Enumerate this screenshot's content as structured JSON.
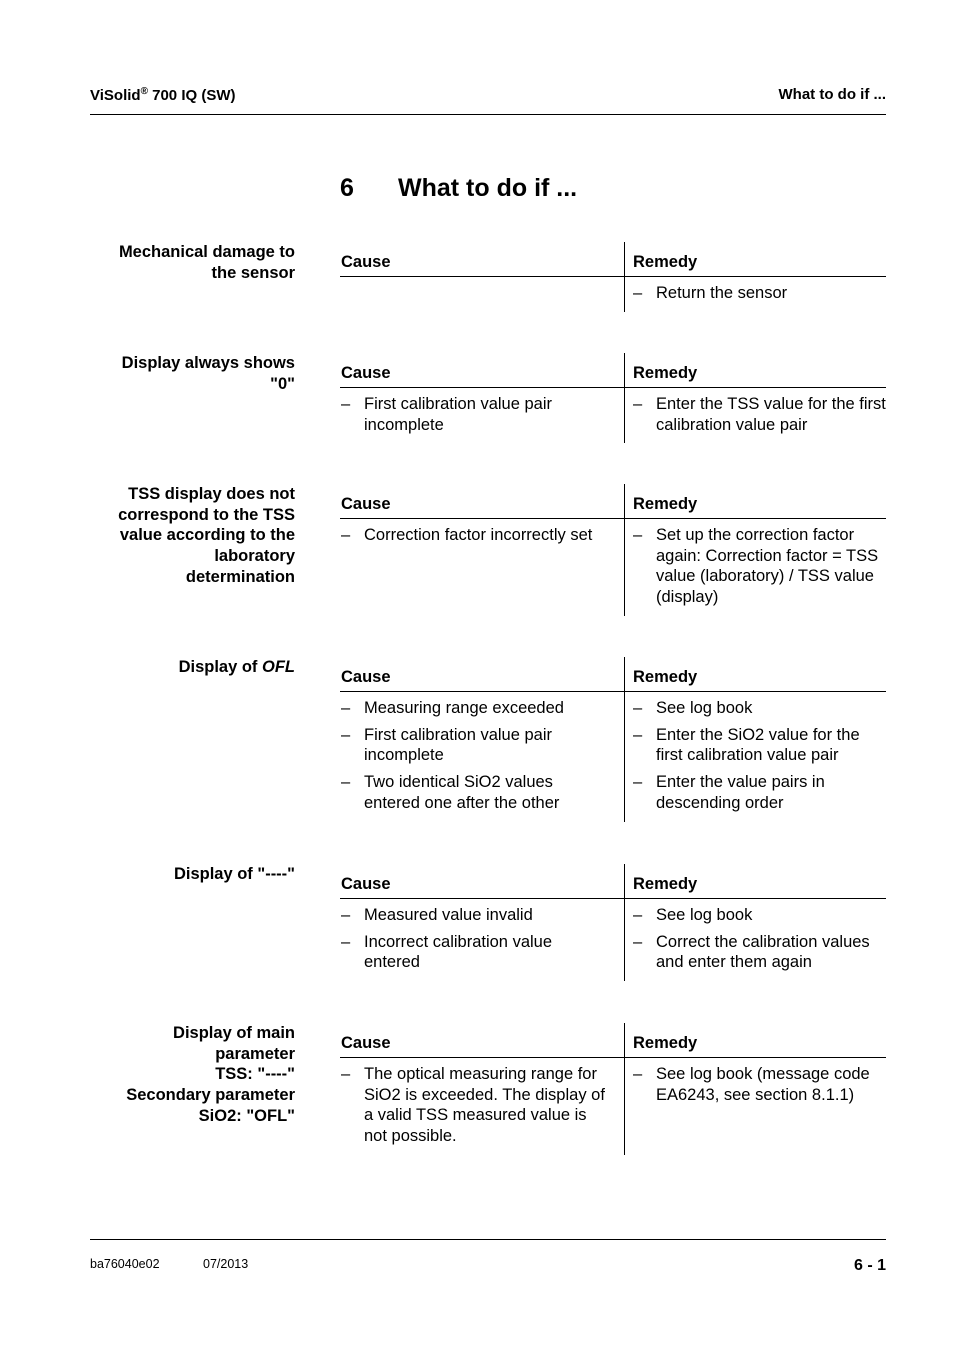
{
  "header": {
    "product": "ViSolid",
    "registered": "®",
    "model": " 700 IQ (SW)",
    "section": "What to do if ..."
  },
  "chapter": {
    "number": "6",
    "title": "What to do if ..."
  },
  "table_headers": {
    "cause": "Cause",
    "remedy": "Remedy"
  },
  "sections": [
    {
      "label": "Mechanical damage to the sensor",
      "causes": [],
      "remedies": [
        "Return the sensor"
      ]
    },
    {
      "label": "Display always shows \"0\"",
      "causes": [
        "First calibration value pair incomplete"
      ],
      "remedies": [
        "Enter the TSS value for the first calibration value pair"
      ]
    },
    {
      "label": "TSS display does not correspond to the TSS value according to the laboratory determination",
      "causes": [
        "Correction factor incorrectly set"
      ],
      "remedies": [
        "Set up the correction factor again: Correction factor = TSS value (laboratory) / TSS value (display)"
      ]
    },
    {
      "label": "Display of ",
      "label_italic": "OFL",
      "causes": [
        "Measuring range exceeded",
        "First calibration value pair incomplete",
        "Two identical SiO2 values entered one after the other"
      ],
      "remedies": [
        "See log book",
        "Enter the SiO2 value for the first calibration value pair",
        "Enter the value pairs in descending order"
      ]
    },
    {
      "label": "Display of \"----\"",
      "causes": [
        "Measured value invalid",
        "Incorrect calibration value entered"
      ],
      "remedies": [
        "See log book",
        "Correct the calibration values and enter them again"
      ]
    },
    {
      "label": "Display of main parameter TSS: \"----\" Secondary parameter SiO2: \"OFL\"",
      "causes": [
        "The optical measuring range for SiO2 is exceeded. The display of a valid TSS measured value is not possible."
      ],
      "remedies": [
        "See log book (message code EA6243, see section 8.1.1)"
      ]
    }
  ],
  "footer": {
    "doc_id": "ba76040e02",
    "date": "07/2013",
    "page": "6 - 1"
  },
  "dash": "–"
}
